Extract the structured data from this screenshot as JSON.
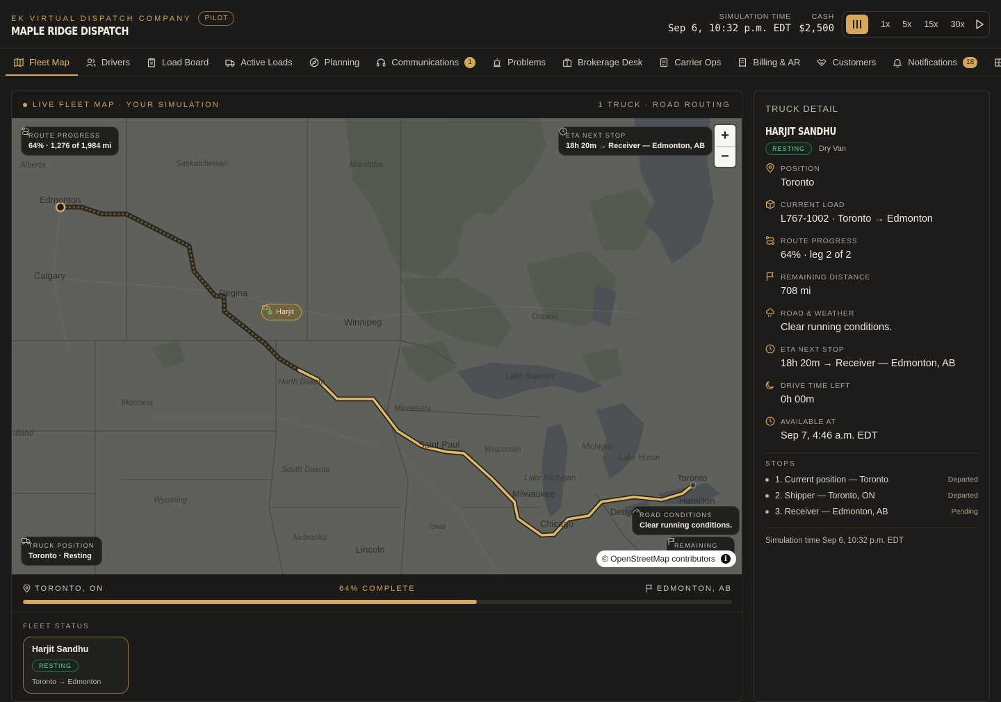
{
  "header": {
    "company": "EK VIRTUAL DISPATCH COMPANY",
    "badge": "PILOT",
    "title": "MAPLE RIDGE DISPATCH",
    "sim_time_label": "SIMULATION TIME",
    "sim_time_value": "Sep 6, 10:32 p.m. EDT",
    "cash_label": "CASH",
    "cash_value": "$2,500",
    "speeds": [
      "1x",
      "5x",
      "15x",
      "30x"
    ]
  },
  "nav": {
    "items": [
      {
        "label": "Fleet Map",
        "icon": "map-icon"
      },
      {
        "label": "Drivers",
        "icon": "users-icon"
      },
      {
        "label": "Load Board",
        "icon": "clipboard-icon"
      },
      {
        "label": "Active Loads",
        "icon": "truck-icon"
      },
      {
        "label": "Planning",
        "icon": "compass-icon"
      },
      {
        "label": "Communications",
        "icon": "headset-icon",
        "badge": "1"
      },
      {
        "label": "Problems",
        "icon": "alert-icon"
      },
      {
        "label": "Brokerage Desk",
        "icon": "building-icon"
      },
      {
        "label": "Carrier Ops",
        "icon": "document-icon"
      },
      {
        "label": "Billing & AR",
        "icon": "receipt-icon"
      },
      {
        "label": "Customers",
        "icon": "handshake-icon"
      },
      {
        "label": "Notifications",
        "icon": "bell-icon",
        "badge": "18"
      }
    ]
  },
  "map": {
    "live_label": "LIVE FLEET MAP · YOUR SIMULATION",
    "routing_label": "1 TRUCK · ROAD ROUTING",
    "route_progress_label": "ROUTE PROGRESS",
    "route_progress_value": "64% · 1,276 of 1,984 mi",
    "eta_label": "ETA NEXT STOP",
    "eta_value": "18h 20m → Receiver — Edmonton, AB",
    "truck_marker": "Harjit",
    "truck_position_label": "TRUCK POSITION",
    "truck_position_value": "Toronto · Resting",
    "road_conditions_label": "ROAD CONDITIONS",
    "road_conditions_value": "Clear running conditions.",
    "remaining_label": "REMAINING",
    "attribution": "© OpenStreetMap contributors",
    "places": [
      "Alberta",
      "Saskatchewan",
      "Manitoba",
      "Edmonton",
      "Calgary",
      "Regina",
      "Winnipeg",
      "Ontario",
      "Lake Superior",
      "North Dakota",
      "Montana",
      "Minnesota",
      "Idaho",
      "South Dakota",
      "Wyoming",
      "Nebraska",
      "Lincoln",
      "Iowa",
      "Wisconsin",
      "Michigan",
      "Lake Michigan",
      "Lake Huron",
      "Milwaukee",
      "Chicago",
      "Detroit",
      "Toronto",
      "Hamilton",
      "Saint Paul"
    ]
  },
  "progress": {
    "origin": "TORONTO, ON",
    "percent_label": "64% COMPLETE",
    "destination": "EDMONTON, AB",
    "fraction": 0.64
  },
  "fleet": {
    "label": "FLEET STATUS",
    "cards": [
      {
        "name": "Harjit Sandhu",
        "status": "RESTING",
        "route": "Toronto → Edmonton"
      }
    ]
  },
  "detail": {
    "title": "TRUCK DETAIL",
    "driver": "HARJIT SANDHU",
    "status": "RESTING",
    "equipment": "Dry Van",
    "rows": [
      {
        "label": "POSITION",
        "value": "Toronto",
        "icon": "pin-icon"
      },
      {
        "label": "CURRENT LOAD",
        "value": "L767-1002 · Toronto → Edmonton",
        "icon": "package-icon"
      },
      {
        "label": "ROUTE PROGRESS",
        "value": "64% · leg 2 of 2",
        "icon": "route-icon"
      },
      {
        "label": "REMAINING DISTANCE",
        "value": "708 mi",
        "icon": "flag-icon"
      },
      {
        "label": "ROAD & WEATHER",
        "value": "Clear running conditions.",
        "icon": "cloud-rain-icon"
      },
      {
        "label": "ETA NEXT STOP",
        "value": "18h 20m → Receiver — Edmonton, AB",
        "icon": "clock-icon"
      },
      {
        "label": "DRIVE TIME LEFT",
        "value": "0h 00m",
        "icon": "moon-icon"
      },
      {
        "label": "AVAILABLE AT",
        "value": "Sep 7, 4:46 a.m. EDT",
        "icon": "clock-icon"
      }
    ],
    "stops_label": "STOPS",
    "stops": [
      {
        "label": "1. Current position — Toronto",
        "status": "Departed"
      },
      {
        "label": "2. Shipper — Toronto, ON",
        "status": "Departed"
      },
      {
        "label": "3. Receiver — Edmonton, AB",
        "status": "Pending"
      }
    ],
    "footer": "Simulation time Sep 6, 10:32 p.m. EDT"
  },
  "colors": {
    "accent": "#d4a85c",
    "resting_green": "#6fcf93",
    "background": "#1b1a18"
  }
}
